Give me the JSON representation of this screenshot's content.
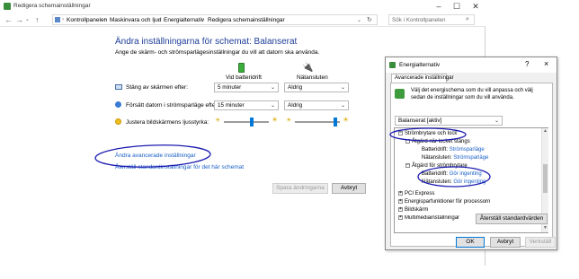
{
  "main_window": {
    "title": "Redigera schemainställningar",
    "breadcrumbs": [
      "Kontrollpanelen",
      "Maskinvara och ljud",
      "Energialternativ",
      "Redigera schemainställningar"
    ],
    "search_placeholder": "Sök i Kontrollpanelen",
    "heading": "Ändra inställningarna för schemat: Balanserat",
    "subheading": "Ange de skärm- och strömsparlägesinställningar du vill att datorn ska använda.",
    "col_battery": "Vid batteridrift",
    "col_plugged": "Nätansluten",
    "rows": [
      {
        "label": "Stäng av skärmen efter:",
        "battery": "5 minuter",
        "plugged": "Aldrig"
      },
      {
        "label": "Försätt datorn i strömsparläge efter:",
        "battery": "15 minuter",
        "plugged": "Aldrig"
      }
    ],
    "brightness_label": "Justera bildskärmens ljusstyrka:",
    "brightness_battery": 0.62,
    "brightness_plugged": 0.93,
    "link_advanced": "Ändra avancerade inställningar",
    "link_restore": "Återställ standardinställningar för det här schemat",
    "save_btn": "Spara ändringarna",
    "cancel_btn": "Avbryt"
  },
  "dialog": {
    "title": "Energialternativ",
    "help": "?",
    "close": "×",
    "tab": "Avancerade inställningar",
    "description": "Välj det energischema som du vill anpassa och välj sedan de inställningar som du vill använda.",
    "plan_select": "Balanserat [aktiv]",
    "tree": [
      {
        "text": "Strömbrytare och lock",
        "expander": "−"
      },
      {
        "text": "Åtgärd när locket stängs",
        "expander": "−"
      },
      {
        "text": "Batteridrift: ",
        "value": "Strömsparläge"
      },
      {
        "text": "Nätansluten: ",
        "value": "Strömsparläge"
      },
      {
        "text": "Åtgärd för strömbrytare",
        "expander": "−"
      },
      {
        "text": "Batteridrift: ",
        "value": "Gör ingenting"
      },
      {
        "text": "Nätansluten: ",
        "value": "Gör ingenting"
      },
      {
        "text": "PCI Express",
        "expander": "+"
      },
      {
        "text": "Energisparfunktioner för processorn",
        "expander": "+"
      },
      {
        "text": "Bildskärm",
        "expander": "+"
      },
      {
        "text": "Multimediainställningar",
        "expander": "+"
      }
    ],
    "restore_btn": "Återställ standardvärden",
    "ok_btn": "OK",
    "cancel_btn": "Avbryt",
    "apply_btn": "Verkställ"
  },
  "colors": {
    "accent": "#0078d7",
    "link": "#1a5fc8",
    "annotation": "#1a1ab0",
    "heading": "#1f3e99"
  }
}
